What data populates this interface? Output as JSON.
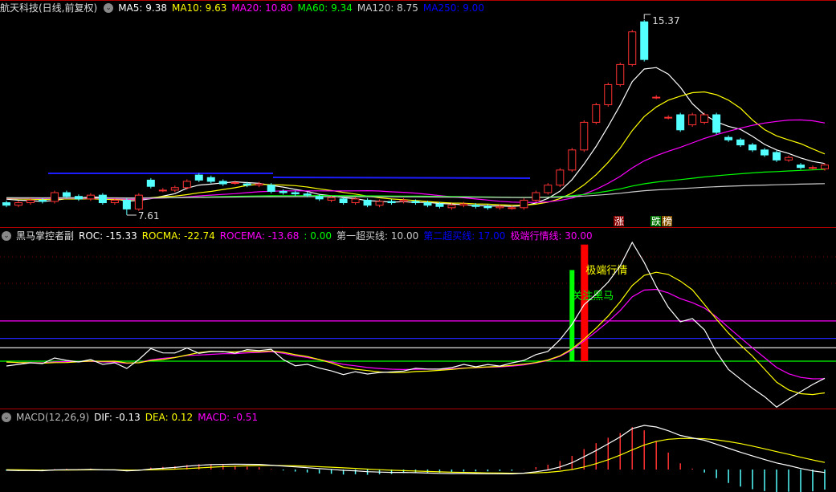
{
  "main": {
    "title": "航天科技(日线,前复权)",
    "ma": [
      {
        "label": "MA5: 9.38",
        "color": "#ffffff"
      },
      {
        "label": "MA10: 9.63",
        "color": "#ffff00"
      },
      {
        "label": "MA20: 10.80",
        "color": "#ff00ff"
      },
      {
        "label": "MA60: 9.34",
        "color": "#00ff00"
      },
      {
        "label": "MA120: 8.75",
        "color": "#cccccc"
      },
      {
        "label": "MA250: 9.00",
        "color": "#0000ff"
      }
    ],
    "high_label": "15.37",
    "low_label": "7.61",
    "badge_up": "涨",
    "badge_down": "跌",
    "badge_list": "榜"
  },
  "roc": {
    "title": "黑马掌控者副",
    "items": [
      {
        "label": "ROC: -15.33",
        "color": "#ffffff"
      },
      {
        "label": "ROCMA: -22.74",
        "color": "#ffff00"
      },
      {
        "label": "ROCEMA: -13.68",
        "color": "#ff00ff"
      },
      {
        "label": ": 0.00",
        "color": "#00ff00"
      },
      {
        "label": "第一超买线: 10.00",
        "color": "#cccccc"
      },
      {
        "label": "第二超买线: 17.00",
        "color": "#0000ff"
      },
      {
        "label": "极端行情线: 30.00",
        "color": "#ff00ff"
      }
    ],
    "signal_green": "关注黑马",
    "signal_red": "极端行情"
  },
  "macd": {
    "title": "MACD(12,26,9)",
    "items": [
      {
        "label": "DIF: -0.13",
        "color": "#ffffff"
      },
      {
        "label": "DEA: 0.12",
        "color": "#ffff00"
      },
      {
        "label": "MACD: -0.51",
        "color": "#ff00ff"
      }
    ]
  },
  "colors": {
    "up": "#ff3232",
    "down": "#54ffff",
    "sep": "#b00000"
  },
  "chart_data": {
    "type": "candlestick",
    "ohlc_open_close": [
      [
        8.1,
        8.0
      ],
      [
        8.0,
        8.1
      ],
      [
        8.1,
        8.2
      ],
      [
        8.2,
        8.15
      ],
      [
        8.15,
        8.5
      ],
      [
        8.5,
        8.35
      ],
      [
        8.35,
        8.25
      ],
      [
        8.25,
        8.4
      ],
      [
        8.4,
        8.1
      ],
      [
        8.1,
        8.2
      ],
      [
        8.2,
        7.85
      ],
      [
        7.85,
        8.4
      ],
      [
        9.0,
        8.75
      ],
      [
        8.6,
        8.6
      ],
      [
        8.6,
        8.7
      ],
      [
        8.7,
        8.95
      ],
      [
        9.2,
        9.0
      ],
      [
        9.1,
        8.95
      ],
      [
        8.95,
        8.85
      ],
      [
        8.9,
        8.9
      ],
      [
        8.85,
        8.8
      ],
      [
        8.8,
        8.85
      ],
      [
        8.8,
        8.55
      ],
      [
        8.55,
        8.5
      ],
      [
        8.5,
        8.45
      ],
      [
        8.45,
        8.4
      ],
      [
        8.35,
        8.25
      ],
      [
        8.2,
        8.3
      ],
      [
        8.25,
        8.1
      ],
      [
        8.1,
        8.25
      ],
      [
        8.2,
        8.0
      ],
      [
        8.0,
        8.15
      ],
      [
        8.15,
        8.1
      ],
      [
        8.15,
        8.2
      ],
      [
        8.15,
        8.1
      ],
      [
        8.1,
        8.0
      ],
      [
        8.05,
        7.95
      ],
      [
        7.9,
        8.0
      ],
      [
        8.0,
        8.05
      ],
      [
        8.0,
        7.95
      ],
      [
        7.95,
        7.9
      ],
      [
        7.9,
        7.95
      ],
      [
        7.9,
        7.9
      ],
      [
        7.9,
        8.2
      ],
      [
        8.2,
        8.5
      ],
      [
        8.5,
        8.8
      ],
      [
        8.8,
        9.4
      ],
      [
        9.4,
        10.2
      ],
      [
        10.2,
        11.3
      ],
      [
        11.3,
        12.0
      ],
      [
        12.0,
        12.8
      ],
      [
        12.8,
        13.6
      ],
      [
        13.6,
        14.9
      ],
      [
        15.3,
        13.8
      ],
      [
        12.3,
        12.3
      ],
      [
        11.5,
        11.5
      ],
      [
        11.6,
        11.0
      ],
      [
        11.2,
        11.6
      ],
      [
        11.3,
        11.6
      ],
      [
        11.6,
        10.9
      ],
      [
        10.7,
        10.6
      ],
      [
        10.6,
        10.4
      ],
      [
        10.4,
        10.2
      ],
      [
        10.2,
        10.0
      ],
      [
        10.1,
        9.8
      ],
      [
        9.8,
        9.9
      ],
      [
        9.6,
        9.5
      ],
      [
        9.5,
        9.5
      ],
      [
        9.45,
        9.6
      ]
    ],
    "price_high": 15.37,
    "price_low": 7.61,
    "roc_lines": [
      30,
      17,
      10,
      0
    ],
    "signal_green_value": 68,
    "signal_red_value": 87
  }
}
